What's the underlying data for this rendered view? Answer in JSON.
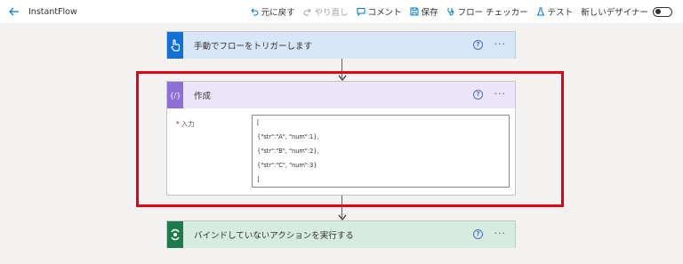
{
  "app": {
    "title": "InstantFlow"
  },
  "toolbar": {
    "undo": "元に戻す",
    "redo": "やり直し",
    "comment": "コメント",
    "save": "保存",
    "flow_checker": "フロー チェッカー",
    "test": "テスト",
    "new_designer": "新しいデザイナー",
    "new_designer_enabled": false
  },
  "flow": {
    "trigger": {
      "title": "手動でフローをトリガーします",
      "icon": "hand-pointer-icon"
    },
    "compose": {
      "title": "作成",
      "icon": "curly-braces-icon",
      "input_label": "入力",
      "required_mark": "*",
      "input_lines": [
        "[",
        "{\"str\":\"A\", \"num\":1},",
        "{\"str\":\"B\", \"num\":2},",
        "{\"str\":\"C\", \"num\":3}",
        "]"
      ]
    },
    "action": {
      "title": "バインドしていないアクションを実行する",
      "icon": "dataverse-icon"
    },
    "help_glyph": "?",
    "more_glyph": "···"
  },
  "colors": {
    "accent": "#0078d4",
    "highlight": "#e60012",
    "trigger_header": "#d7e7f8",
    "compose_header": "#ebe4fa",
    "action_header": "#d7ece0"
  }
}
